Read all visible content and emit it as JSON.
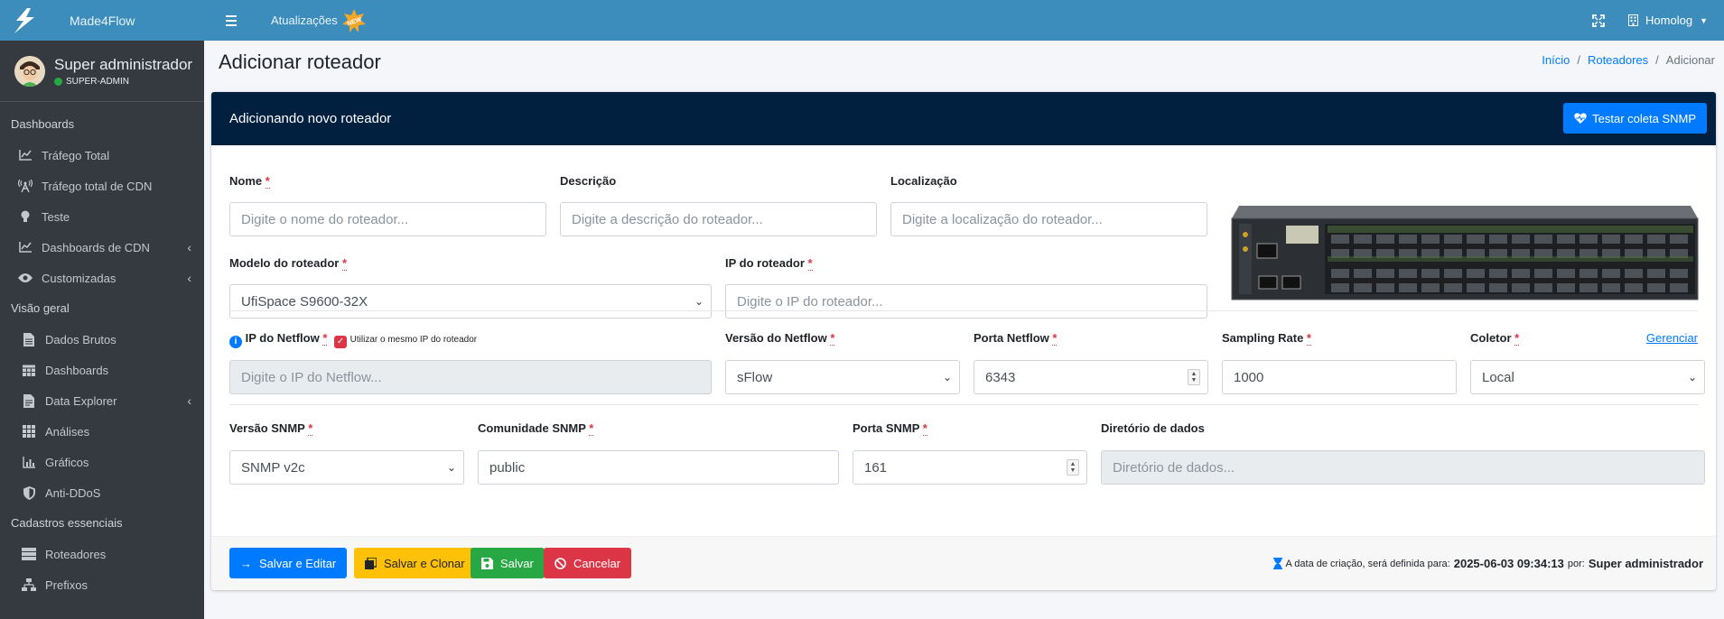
{
  "topbar": {
    "brand": "Made4Flow",
    "updates_label": "Atualizações",
    "new_badge": "NEW",
    "environment": "Homolog"
  },
  "sidebar": {
    "user_name": "Super administrador",
    "user_role": "SUPER-ADMIN",
    "sections": [
      {
        "header": "Dashboards",
        "items": [
          "Tráfego Total",
          "Tráfego total de CDN",
          "Teste",
          "Dashboards de CDN",
          "Customizadas"
        ]
      },
      {
        "header": "Visão geral",
        "items": [
          "Dados Brutos",
          "Dashboards",
          "Data Explorer",
          "Análises",
          "Gráficos",
          "Anti-DDoS"
        ]
      },
      {
        "header": "Cadastros essenciais",
        "items": [
          "Roteadores",
          "Prefixos"
        ]
      }
    ]
  },
  "page": {
    "title": "Adicionar roteador",
    "breadcrumb": [
      "Início",
      "Roteadores",
      "Adicionar"
    ]
  },
  "card": {
    "header_title": "Adicionando novo roteador",
    "test_button": "Testar coleta SNMP"
  },
  "form": {
    "name": {
      "label": "Nome",
      "placeholder": "Digite o nome do roteador..."
    },
    "description": {
      "label": "Descrição",
      "placeholder": "Digite a descrição do roteador..."
    },
    "location": {
      "label": "Localização",
      "placeholder": "Digite a localização do roteador..."
    },
    "model": {
      "label": "Modelo do roteador",
      "value": "UfiSpace S9600-32X"
    },
    "ip": {
      "label": "IP do roteador",
      "placeholder": "Digite o IP do roteador..."
    },
    "netflow_ip": {
      "label": "IP do Netflow",
      "checkbox_label": "Utilizar o mesmo IP do roteador",
      "placeholder": "Digite o IP do Netflow..."
    },
    "netflow_version": {
      "label": "Versão do Netflow",
      "value": "sFlow"
    },
    "netflow_port": {
      "label": "Porta Netflow",
      "value": "6343"
    },
    "sampling_rate": {
      "label": "Sampling Rate",
      "value": "1000"
    },
    "collector": {
      "label": "Coletor",
      "value": "Local",
      "manage_link": "Gerenciar"
    },
    "snmp_version": {
      "label": "Versão SNMP",
      "value": "SNMP v2c"
    },
    "snmp_community": {
      "label": "Comunidade SNMP",
      "value": "public"
    },
    "snmp_port": {
      "label": "Porta SNMP",
      "value": "161"
    },
    "data_dir": {
      "label": "Diretório de dados",
      "placeholder": "Diretório de dados..."
    }
  },
  "footer": {
    "save_edit": "Salvar e Editar",
    "save_clone": "Salvar e Clonar",
    "save": "Salvar",
    "cancel": "Cancelar",
    "note_prefix": "A data de criação, será definida para:",
    "note_date": "2025-06-03 09:34:13",
    "note_by": "por:",
    "note_user": "Super administrador"
  },
  "colors": {
    "topbar": "#3c8dbc",
    "sidebar": "#343a40",
    "card_header": "#011f3f",
    "primary": "#007bff",
    "warning": "#ffc107",
    "success": "#28a745",
    "danger": "#dc3545"
  }
}
